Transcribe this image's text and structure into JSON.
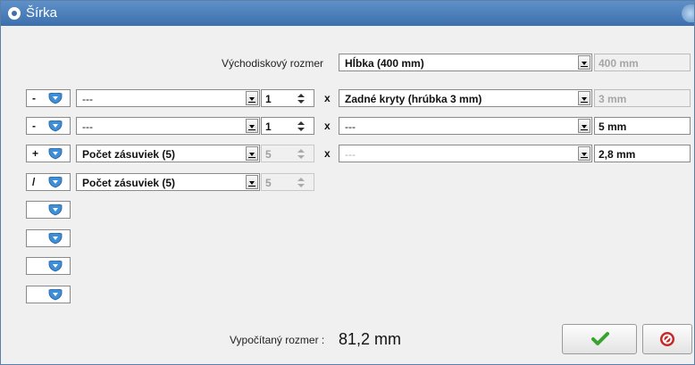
{
  "window": {
    "title": "Šírka"
  },
  "base": {
    "label": "Východiskový rozmer",
    "combo_value": "Hĺbka  (400 mm)",
    "field_value": "400 mm"
  },
  "rows": [
    {
      "operator": "-",
      "combo": "---",
      "spin": "1",
      "spin_enabled": true,
      "x": "x",
      "combo2": "Zadné kryty  (hrúbka 3 mm)",
      "value": "3 mm",
      "value_readonly": true
    },
    {
      "operator": "-",
      "combo": "---",
      "spin": "1",
      "spin_enabled": true,
      "x": "x",
      "combo2": "---",
      "value": "5 mm",
      "value_readonly": false
    },
    {
      "operator": "+",
      "combo": "Počet zásuviek (5)",
      "spin": "5",
      "spin_enabled": false,
      "x": "x",
      "combo2": "---",
      "combo2_disabled": true,
      "value": "2,8 mm",
      "value_readonly": false
    },
    {
      "operator": "/",
      "combo": "Počet zásuviek (5)",
      "spin": "5",
      "spin_enabled": false
    },
    {
      "operator": ""
    },
    {
      "operator": ""
    },
    {
      "operator": ""
    },
    {
      "operator": ""
    }
  ],
  "computed": {
    "label": "Vypočítaný rozmer :",
    "value": "81,2 mm"
  },
  "buttons": {
    "ok_icon": "checkmark-icon",
    "cancel_icon": "cancel-icon"
  },
  "colors": {
    "titlebar": "#3c70ad",
    "shield": "#3f8fd8",
    "ok": "#3aa32f",
    "cancel": "#c62828"
  }
}
